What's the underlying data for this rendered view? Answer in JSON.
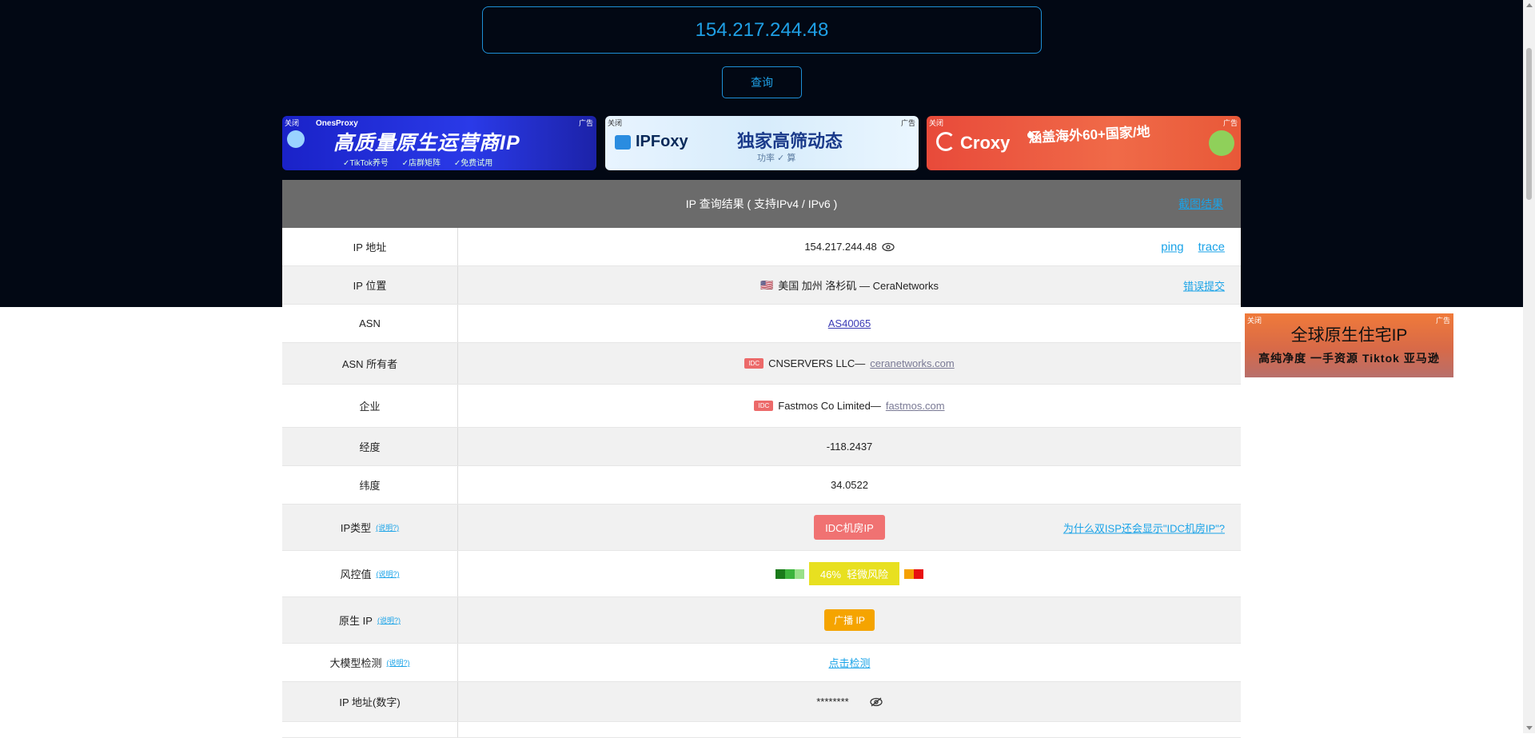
{
  "search": {
    "ip_value": "154.217.244.48",
    "button_label": "查询"
  },
  "ads": [
    {
      "close": "关闭",
      "tag": "广告",
      "brand": "OnesProxy",
      "headline": "高质量原生运营商IP",
      "sub": "✓TikTok养号 ✓店群矩阵 ✓免费试用"
    },
    {
      "close": "关闭",
      "tag": "广告",
      "brand": "IPFoxy",
      "headline": "独家高筛动态",
      "sub": "功率 ✓ 算"
    },
    {
      "close": "关闭",
      "tag": "广告",
      "brand": "Croxy",
      "headline": "涵盖海外60+国家/地"
    }
  ],
  "side_ad": {
    "close": "关闭",
    "tag": "广告",
    "headline": "全球原生住宅IP",
    "sub": "高纯净度 一手资源 Tiktok 亚马逊"
  },
  "table": {
    "title": "IP 查询结果 ( 支持IPv4 / IPv6 )",
    "screenshot_link": "截图结果",
    "rows": {
      "ip": {
        "label": "IP 地址",
        "value": "154.217.244.48",
        "ping": "ping",
        "trace": "trace"
      },
      "location": {
        "label": "IP 位置",
        "flag": "🇺🇸",
        "value": "美国 加州 洛杉矶 — CeraNetworks",
        "report": "错误提交"
      },
      "asn": {
        "label": "ASN",
        "value": "AS40065"
      },
      "asn_owner": {
        "label": "ASN 所有者",
        "tag": "IDC",
        "name": "CNSERVERS LLC—",
        "domain": "ceranetworks.com"
      },
      "company": {
        "label": "企业",
        "tag": "IDC",
        "name": "Fastmos Co Limited—",
        "domain": "fastmos.com"
      },
      "longitude": {
        "label": "经度",
        "value": "-118.2437"
      },
      "latitude": {
        "label": "纬度",
        "value": "34.0522"
      },
      "ip_type": {
        "label": "IP类型",
        "note": "(说明?)",
        "value": "IDC机房IP",
        "help": "为什么双ISP还会显示\"IDC机房IP\"?"
      },
      "risk": {
        "label": "风控值",
        "note": "(说明?)",
        "percent": "46%",
        "level": "轻微风险",
        "value_pct": 46
      },
      "native": {
        "label": "原生 IP",
        "note": "(说明?)",
        "value": "广播 IP"
      },
      "llm": {
        "label": "大模型检测",
        "note": "(说明?)",
        "value": "点击检测"
      },
      "ip_numeric": {
        "label": "IP 地址(数字)",
        "value": "********"
      }
    }
  },
  "colors": {
    "accent": "#1aa3e8",
    "dark_bg": "#020814",
    "header_gray": "#6b6b6b",
    "idc_red": "#f07272",
    "risk_yellow": "#e8e020",
    "native_orange": "#f5a400"
  }
}
